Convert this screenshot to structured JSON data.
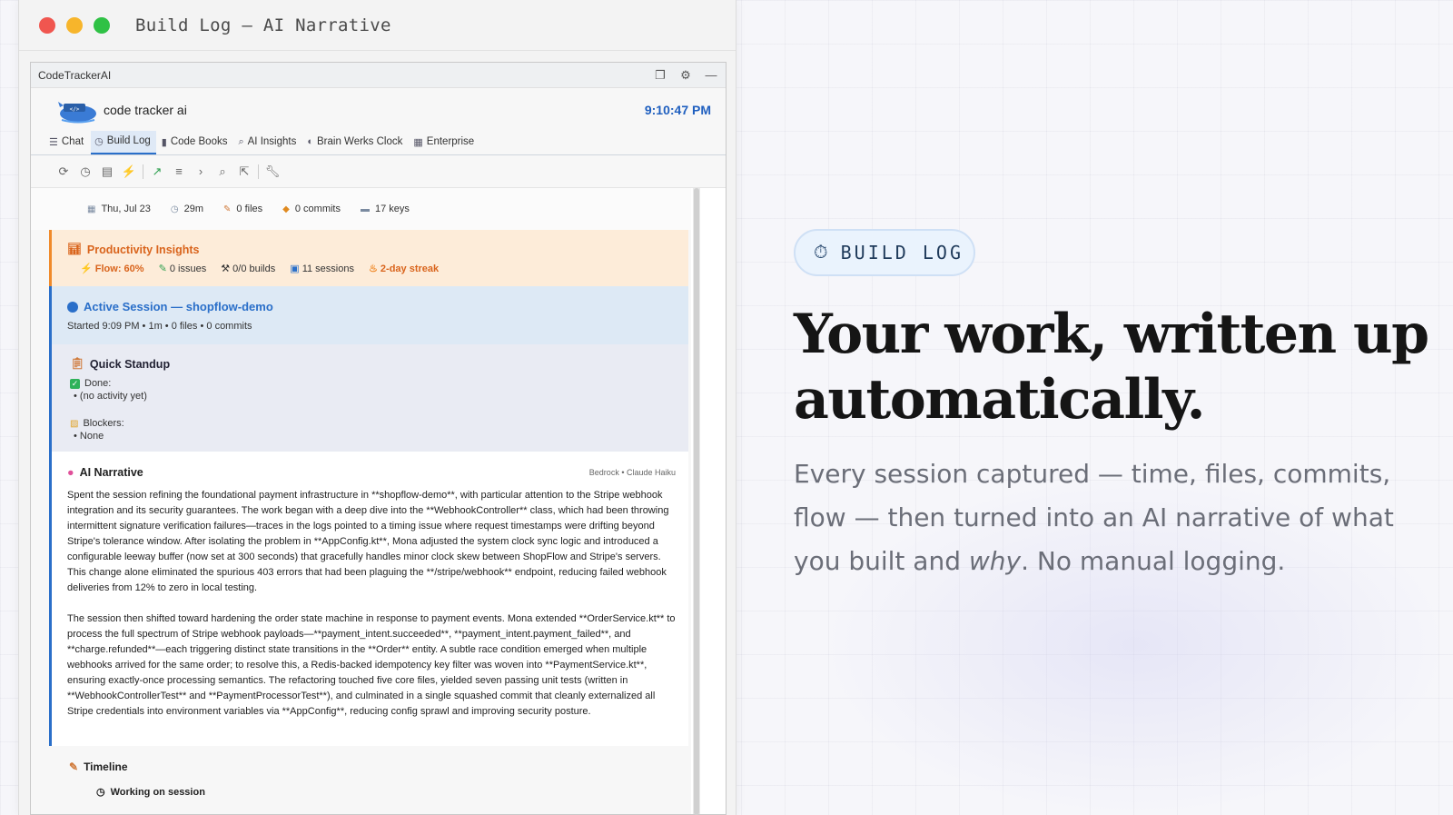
{
  "window": {
    "title": "Build Log — AI Narrative"
  },
  "app": {
    "name": "CodeTrackerAI",
    "brand": "code tracker ai",
    "clock": "9:10:47 PM",
    "tabs": [
      {
        "label": "Chat",
        "icon": "lines-icon",
        "active": false
      },
      {
        "label": "Build Log",
        "icon": "clock-icon",
        "active": true
      },
      {
        "label": "Code Books",
        "icon": "book-icon",
        "active": false
      },
      {
        "label": "AI Insights",
        "icon": "search-icon",
        "active": false
      },
      {
        "label": "Brain Werks Clock",
        "icon": "brain-icon",
        "active": false
      },
      {
        "label": "Enterprise",
        "icon": "building-icon",
        "active": false
      }
    ]
  },
  "stats": {
    "date": "Thu, Jul 23",
    "duration": "29m",
    "files": "0 files",
    "commits": "0 commits",
    "keys": "17 keys"
  },
  "productivity": {
    "title": "Productivity Insights",
    "flow": "Flow: 60%",
    "issues": "0 issues",
    "builds": "0/0 builds",
    "sessions": "11 sessions",
    "streak": "2-day streak",
    "color": "#d9641c"
  },
  "active_session": {
    "title": "Active Session — shopflow-demo",
    "meta": "Started 9:09 PM  •  1m  •  0 files  •  0 commits"
  },
  "standup": {
    "title": "Quick Standup",
    "done_label": "Done:",
    "done_item": "• (no activity yet)",
    "blockers_label": "Blockers:",
    "blockers_item": "• None"
  },
  "narrative": {
    "title": "AI Narrative",
    "source": "Bedrock • Claude Haiku",
    "p1": "Spent the session refining the foundational payment infrastructure in **shopflow-demo**, with particular attention to the Stripe webhook integration and its security guarantees. The work began with a deep dive into the **WebhookController** class, which had been throwing intermittent signature verification failures—traces in the logs pointed to a timing issue where request timestamps were drifting beyond Stripe's tolerance window. After isolating the problem in **AppConfig.kt**, Mona adjusted the system clock sync logic and introduced a configurable leeway buffer (now set at 300 seconds) that gracefully handles minor clock skew between ShopFlow and Stripe's servers. This change alone eliminated the spurious 403 errors that had been plaguing the **/stripe/webhook** endpoint, reducing failed webhook deliveries from 12% to zero in local testing.",
    "p2": "The session then shifted toward hardening the order state machine in response to payment events. Mona extended **OrderService.kt** to process the full spectrum of Stripe webhook payloads—**payment_intent.succeeded**, **payment_intent.payment_failed**, and **charge.refunded**—each triggering distinct state transitions in the **Order** entity. A subtle race condition emerged when multiple webhooks arrived for the same order; to resolve this, a Redis-backed idempotency key filter was woven into **PaymentService.kt**, ensuring exactly-once processing semantics. The refactoring touched five core files, yielded seven passing unit tests (written in **WebhookControllerTest** and **PaymentProcessorTest**), and culminated in a single squashed commit that cleanly externalized all Stripe credentials into environment variables via **AppConfig**, reducing config sprawl and improving security posture."
  },
  "timeline": {
    "title": "Timeline",
    "item": "Working on session"
  },
  "marketing": {
    "pill": "BUILD LOG",
    "headline_line1": "Your work, written up",
    "headline_line2": "automatically.",
    "sub_before": "Every session captured — time, files, commits, flow — then turned into an AI narrative of what you built and ",
    "sub_em": "why",
    "sub_after": ". No manual logging."
  },
  "colors": {
    "accent": "#2a6fc9",
    "orange": "#f08a2a"
  }
}
